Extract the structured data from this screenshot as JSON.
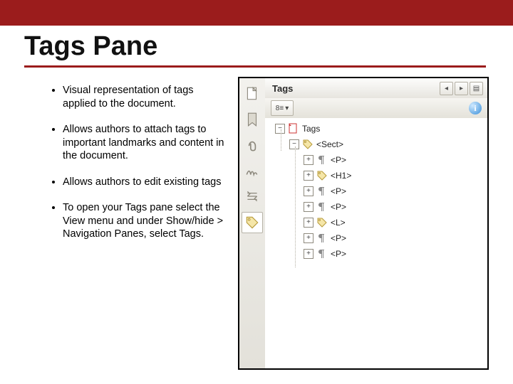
{
  "title": "Tags Pane",
  "bullets": [
    "Visual representation of tags applied to the document.",
    "Allows authors to attach tags to important landmarks and content in the document.",
    "Allows authors to edit existing tags",
    "To open your Tags pane select the View menu and under Show/hide > Navigation Panes, select Tags."
  ],
  "panel": {
    "title": "Tags",
    "nav_icons": [
      "page-icon",
      "bookmark-icon",
      "attachment-icon",
      "signature-icon",
      "order-icon",
      "tag-icon"
    ],
    "toolbar_dropdown": "8≡",
    "tree": {
      "root": "Tags",
      "sect": "<Sect>",
      "children": [
        "<P>",
        "<H1>",
        "<P>",
        "<P>",
        "<L>",
        "<P>",
        "<P>"
      ]
    }
  }
}
